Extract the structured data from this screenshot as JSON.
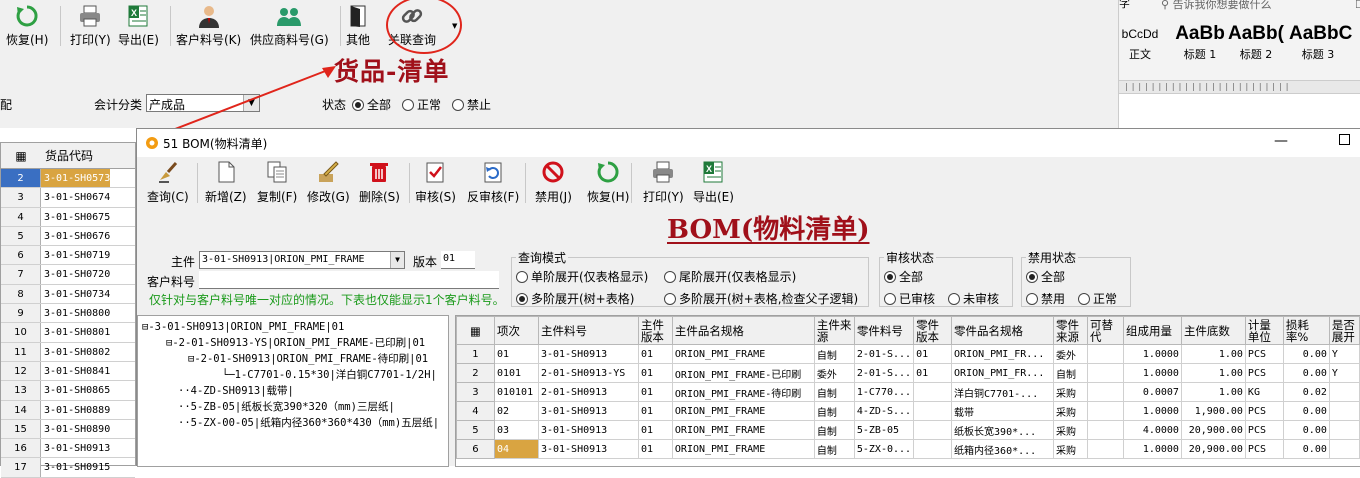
{
  "toolbar": {
    "buttons": [
      {
        "label": "恢复(H)",
        "icon": "restore-icon"
      },
      {
        "label": "打印(Y)",
        "icon": "printer-icon"
      },
      {
        "label": "导出(E)",
        "icon": "excel-export-icon"
      },
      {
        "label": "客户料号(K)",
        "icon": "person-icon"
      },
      {
        "label": "供应商料号(G)",
        "icon": "group-icon"
      },
      {
        "label": "其他",
        "icon": "door-icon"
      },
      {
        "label": "关联查询",
        "icon": "link-icon"
      }
    ]
  },
  "annotation": {
    "label": "货品-清单",
    "color": "#e0251b"
  },
  "bg_filters": {
    "prefix": "配",
    "category_label": "会计分类",
    "category_value": "产成品",
    "status_label": "状态",
    "status_options": [
      "全部",
      "正常",
      "禁止"
    ],
    "status_selected": "全部"
  },
  "word": {
    "top_text": "字",
    "search_placeholder": "告诉我你想要做什么",
    "styles": [
      {
        "sample": "bCcDd",
        "label": "正文"
      },
      {
        "sample": "AaBb",
        "label": "标题 1"
      },
      {
        "sample": "AaBb(",
        "label": "标题 2"
      },
      {
        "sample": "AaBbC",
        "label": "标题 3"
      }
    ]
  },
  "left_list": {
    "header": "货品代码",
    "rows": [
      {
        "n": "2",
        "v": "3-01-SH0573",
        "selected": true
      },
      {
        "n": "3",
        "v": "3-01-SH0674"
      },
      {
        "n": "4",
        "v": "3-01-SH0675"
      },
      {
        "n": "5",
        "v": "3-01-SH0676"
      },
      {
        "n": "6",
        "v": "3-01-SH0719"
      },
      {
        "n": "7",
        "v": "3-01-SH0720"
      },
      {
        "n": "8",
        "v": "3-01-SH0734"
      },
      {
        "n": "9",
        "v": "3-01-SH0800"
      },
      {
        "n": "10",
        "v": "3-01-SH0801"
      },
      {
        "n": "11",
        "v": "3-01-SH0802"
      },
      {
        "n": "12",
        "v": "3-01-SH0841"
      },
      {
        "n": "13",
        "v": "3-01-SH0865"
      },
      {
        "n": "14",
        "v": "3-01-SH0889"
      },
      {
        "n": "15",
        "v": "3-01-SH0890"
      },
      {
        "n": "16",
        "v": "3-01-SH0913"
      },
      {
        "n": "17",
        "v": "3-01-SH0915"
      }
    ]
  },
  "bom": {
    "window_title": "51 BOM(物料清单)",
    "heading": "BOM(物料清单)",
    "buttons": [
      {
        "label": "查询(C)",
        "icon": "search-broom-icon"
      },
      {
        "label": "新增(Z)",
        "icon": "new-doc-icon"
      },
      {
        "label": "复制(F)",
        "icon": "copy-icon"
      },
      {
        "label": "修改(G)",
        "icon": "edit-icon"
      },
      {
        "label": "删除(S)",
        "icon": "delete-icon"
      },
      {
        "label": "审核(S)",
        "icon": "approve-icon"
      },
      {
        "label": "反审核(F)",
        "icon": "unapprove-icon"
      },
      {
        "label": "禁用(J)",
        "icon": "forbid-icon"
      },
      {
        "label": "恢复(H)",
        "icon": "restore-icon"
      },
      {
        "label": "打印(Y)",
        "icon": "printer-icon"
      },
      {
        "label": "导出(E)",
        "icon": "excel-export-icon"
      }
    ],
    "main_label": "主件",
    "main_value": "3-01-SH0913|ORION_PMI_FRAME",
    "version_label": "版本",
    "version_value": "01",
    "customer_label": "客户料号",
    "customer_value": "",
    "hint": "仅针对与客户料号唯一对应的情况。下表也仅能显示1个客户料号。",
    "query_mode": {
      "caption": "查询模式",
      "options": [
        "单阶展开(仅表格显示)",
        "尾阶展开(仅表格显示)",
        "多阶展开(树+表格)",
        "多阶展开(树+表格,检查父子逻辑)"
      ],
      "selected": "多阶展开(树+表格)"
    },
    "audit_status": {
      "caption": "审核状态",
      "options": [
        "全部",
        "已审核",
        "未审核"
      ],
      "selected": "全部"
    },
    "disable_status": {
      "caption": "禁用状态",
      "options": [
        "全部",
        "禁用",
        "正常"
      ],
      "selected": "全部"
    },
    "tree": [
      "3-01-SH0913|ORION_PMI_FRAME|01",
      "2-01-SH0913-YS|ORION_PMI_FRAME-已印刷|01",
      "2-01-SH0913|ORION_PMI_FRAME-待印刷|01",
      "1-C7701-0.15*30|洋白铜C7701-1/2H|",
      "4-ZD-SH0913|载带|",
      "5-ZB-05|纸板长宽390*320（mm)三层纸|",
      "5-ZX-00-05|纸箱内径360*360*430（mm)五层纸|"
    ],
    "grid": {
      "columns": [
        "项次",
        "主件料号",
        "主件版本",
        "主件品名规格",
        "主件来源",
        "零件料号",
        "零件版本",
        "零件品名规格",
        "零件来源",
        "可替代",
        "组成用量",
        "主件底数",
        "计量单位",
        "损耗率%",
        "是否展开"
      ],
      "rows": [
        [
          "1",
          "01",
          "3-01-SH0913",
          "01",
          "ORION_PMI_FRAME",
          "自制",
          "2-01-S...",
          "01",
          "ORION_PMI_FR...",
          "委外",
          "",
          "1.0000",
          "1.00",
          "PCS",
          "0.00",
          "Y"
        ],
        [
          "2",
          "0101",
          "2-01-SH0913-YS",
          "01",
          "ORION_PMI_FRAME-已印刷",
          "委外",
          "2-01-S...",
          "01",
          "ORION_PMI_FR...",
          "自制",
          "",
          "1.0000",
          "1.00",
          "PCS",
          "0.00",
          "Y"
        ],
        [
          "3",
          "010101",
          "2-01-SH0913",
          "01",
          "ORION_PMI_FRAME-待印刷",
          "自制",
          "1-C770...",
          "",
          "洋白铜C7701-...",
          "采购",
          "",
          "0.0007",
          "1.00",
          "KG",
          "0.02",
          ""
        ],
        [
          "4",
          "02",
          "3-01-SH0913",
          "01",
          "ORION_PMI_FRAME",
          "自制",
          "4-ZD-S...",
          "",
          "载带",
          "采购",
          "",
          "1.0000",
          "1,900.00",
          "PCS",
          "0.00",
          ""
        ],
        [
          "5",
          "03",
          "3-01-SH0913",
          "01",
          "ORION_PMI_FRAME",
          "自制",
          "5-ZB-05",
          "",
          "纸板长宽390*...",
          "采购",
          "",
          "4.0000",
          "20,900.00",
          "PCS",
          "0.00",
          ""
        ],
        [
          "6",
          "04",
          "3-01-SH0913",
          "01",
          "ORION_PMI_FRAME",
          "自制",
          "5-ZX-0...",
          "",
          "纸箱内径360*...",
          "采购",
          "",
          "1.0000",
          "20,900.00",
          "PCS",
          "0.00",
          ""
        ]
      ]
    }
  }
}
